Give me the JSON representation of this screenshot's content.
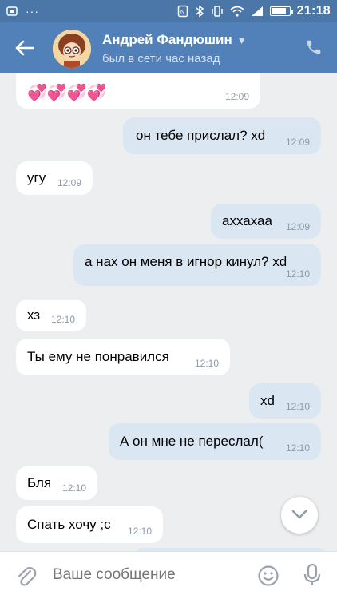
{
  "status_bar": {
    "time": "21:18",
    "battery_level": 0.9,
    "icons": [
      "notification-dots-icon",
      "dots-icon",
      "nfc-icon",
      "bluetooth-icon",
      "vibrate-icon",
      "wifi-icon",
      "signal-icon",
      "battery-icon"
    ]
  },
  "header": {
    "peer_name": "Андрей Фандюшин",
    "peer_status": "был в сети час назад",
    "icons": [
      "back-arrow-icon",
      "chevron-down-icon",
      "phone-icon"
    ]
  },
  "messages": [
    {
      "dir": "in",
      "text": "💞💞💞💞",
      "time": "12:09",
      "kind": "emoji"
    },
    {
      "dir": "out",
      "text": "он тебе прислал? xd",
      "time": "12:09"
    },
    {
      "dir": "in",
      "text": "угу",
      "time": "12:09"
    },
    {
      "dir": "out",
      "text": "аххахаа",
      "time": "12:09"
    },
    {
      "dir": "out",
      "text": "а нах он меня в игнор кинул? xd",
      "time": "12:10"
    },
    {
      "dir": "in",
      "text": "хз",
      "time": "12:10"
    },
    {
      "dir": "in",
      "text": "Ты ему не понравился",
      "time": "12:10"
    },
    {
      "dir": "out",
      "text": "xd",
      "time": "12:10"
    },
    {
      "dir": "out",
      "text": "А он мне не переслал(",
      "time": "12:10"
    },
    {
      "dir": "in",
      "text": "Бля",
      "time": "12:10"
    },
    {
      "dir": "in",
      "text": "Спать хочу ;с",
      "time": "12:10"
    }
  ],
  "composer": {
    "placeholder": "Ваше сообщение",
    "icons": [
      "attach-icon",
      "emoji-icon",
      "microphone-icon"
    ]
  },
  "colors": {
    "header": "#5181b8",
    "statusbar": "#4a76a8",
    "chat_bg": "#edeef0",
    "incoming": "#ffffff",
    "outgoing": "#dbe6f3",
    "time": "#8f9aa6"
  }
}
